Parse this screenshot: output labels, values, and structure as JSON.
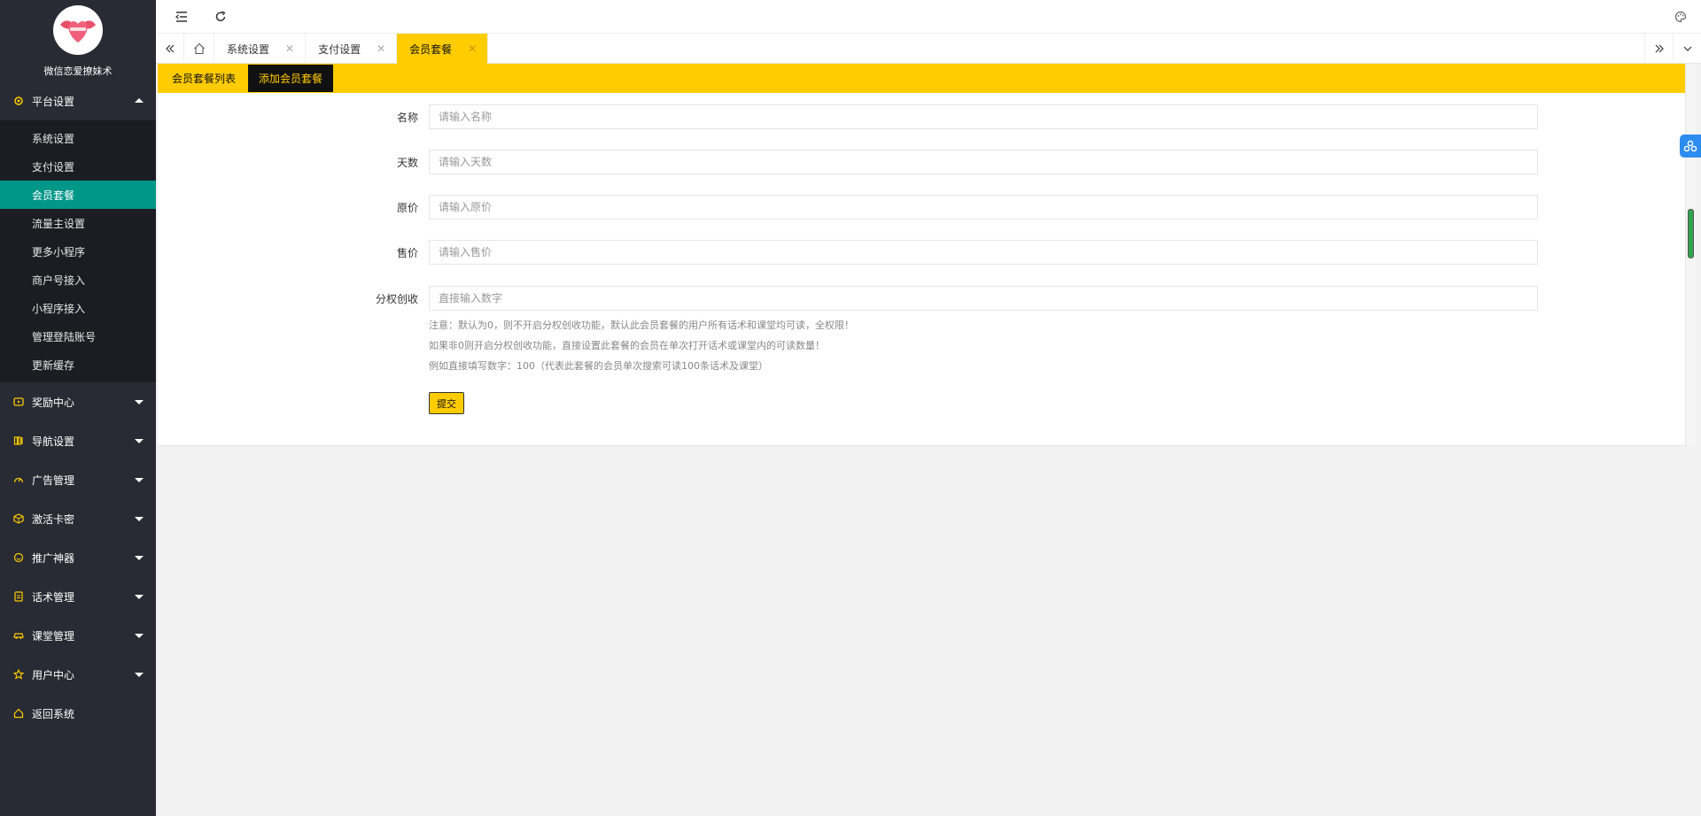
{
  "app": {
    "logo_text": "微信恋爱撩妹术"
  },
  "sidebar": {
    "platform_title": "平台设置",
    "platform_items": [
      {
        "label": "系统设置"
      },
      {
        "label": "支付设置"
      },
      {
        "label": "会员套餐",
        "active": true
      },
      {
        "label": "流量主设置"
      },
      {
        "label": "更多小程序"
      },
      {
        "label": "商户号接入"
      },
      {
        "label": "小程序接入"
      },
      {
        "label": "管理登陆账号"
      },
      {
        "label": "更新缓存"
      }
    ],
    "groups": [
      {
        "label": "奖励中心",
        "icon": "play-square-icon"
      },
      {
        "label": "导航设置",
        "icon": "book-icon"
      },
      {
        "label": "广告管理",
        "icon": "gauge-icon"
      },
      {
        "label": "激活卡密",
        "icon": "cube-icon"
      },
      {
        "label": "推广神器",
        "icon": "smile-icon"
      },
      {
        "label": "话术管理",
        "icon": "document-icon"
      },
      {
        "label": "课堂管理",
        "icon": "car-icon"
      },
      {
        "label": "用户中心",
        "icon": "star-icon"
      }
    ],
    "return_label": "返回系统"
  },
  "tabs": [
    {
      "label": "系统设置",
      "active": false
    },
    {
      "label": "支付设置",
      "active": false
    },
    {
      "label": "会员套餐",
      "active": true
    }
  ],
  "subtabs": {
    "list_label": "会员套餐列表",
    "add_label": "添加会员套餐"
  },
  "form": {
    "name_label": "名称",
    "name_placeholder": "请输入名称",
    "days_label": "天数",
    "days_placeholder": "请输入天数",
    "original_price_label": "原价",
    "original_price_placeholder": "请输入原价",
    "sale_price_label": "售价",
    "sale_price_placeholder": "请输入售价",
    "share_label": "分权创收",
    "share_placeholder": "直接输入数字",
    "hint1": "注意：默认为0，则不开启分权创收功能，默认此会员套餐的用户所有话术和课堂均可读，全权限！",
    "hint2": "如果非0则开启分权创收功能，直接设置此套餐的会员在单次打开话术或课堂内的可读数量！",
    "hint3": "例如直接填写数字：100（代表此套餐的会员单次搜索可读100条话术及课堂）",
    "submit_label": "提交"
  },
  "colors": {
    "accent": "#ffcc00",
    "sidebar_bg": "#282b33",
    "active_item": "#009688"
  }
}
